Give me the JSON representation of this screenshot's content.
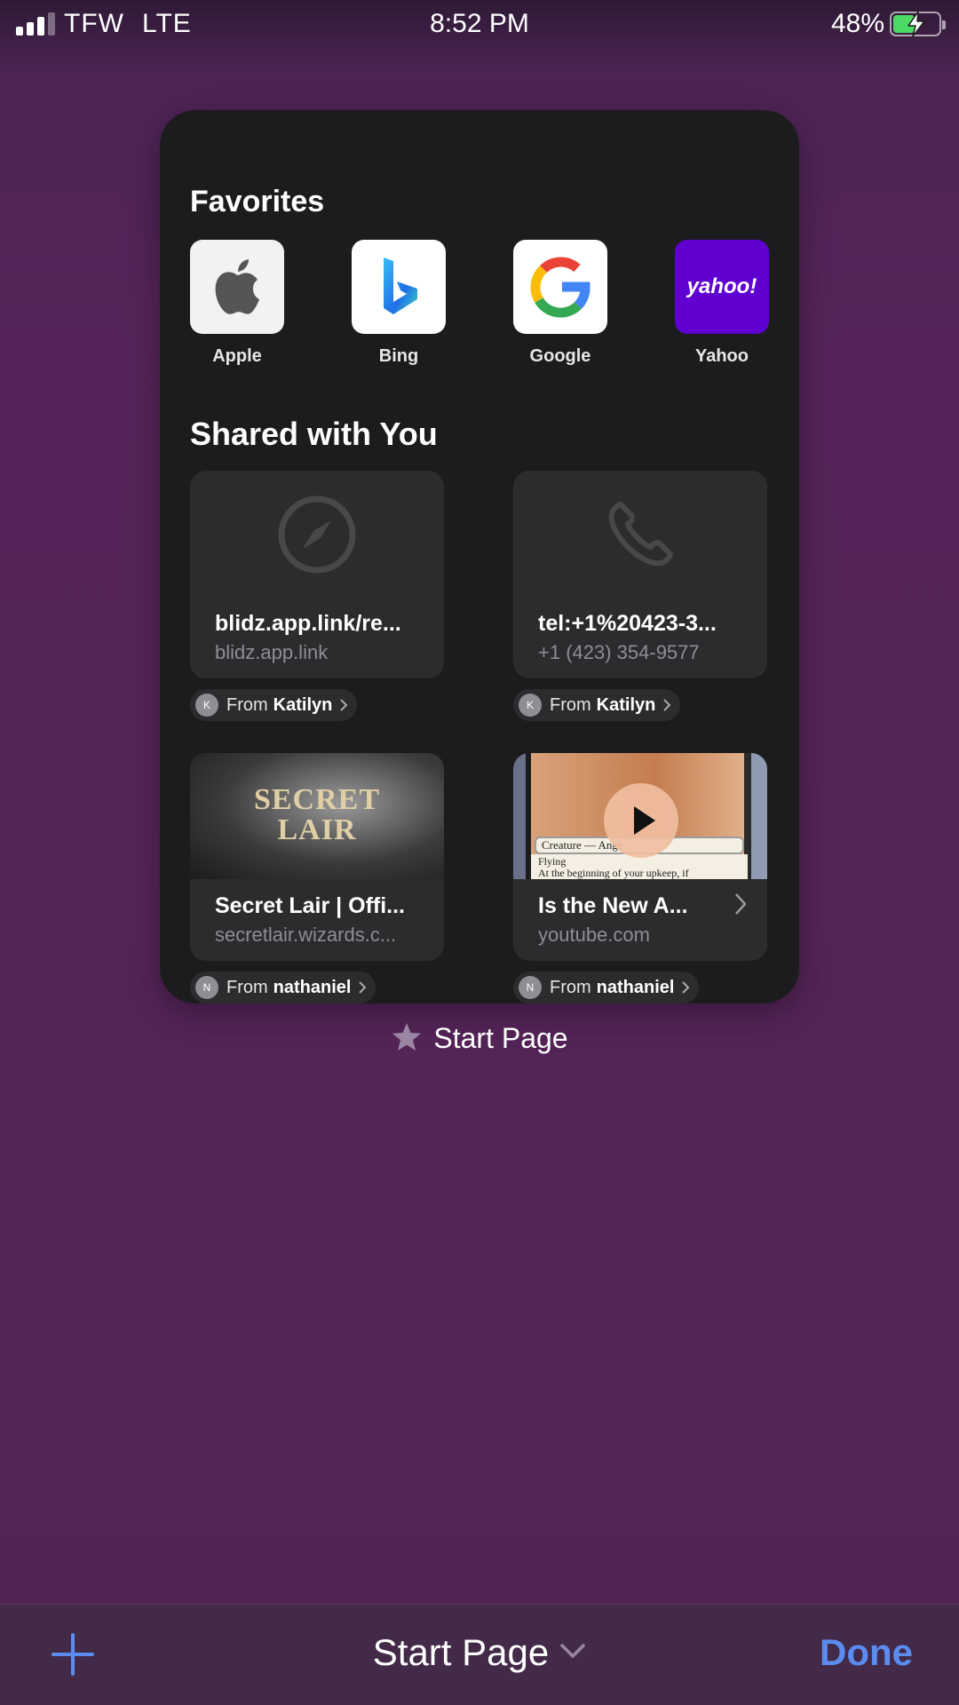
{
  "status_bar": {
    "carrier": "TFW",
    "network": "LTE",
    "time": "8:52 PM",
    "battery_percent": "48%",
    "battery_level": 0.48,
    "battery_charging": true
  },
  "start_page": {
    "favorites_title": "Favorites",
    "favorites": [
      {
        "label": "Apple",
        "icon": "apple-logo-icon"
      },
      {
        "label": "Bing",
        "icon": "bing-logo-icon"
      },
      {
        "label": "Google",
        "icon": "google-logo-icon"
      },
      {
        "label": "Yahoo",
        "icon": "yahoo-logo-icon",
        "logo_text": "yahoo!"
      }
    ],
    "shared_title": "Shared with You",
    "shared": [
      {
        "title": "blidz.app.link/re...",
        "subtitle": "blidz.app.link",
        "icon": "compass-icon",
        "from_prefix": "From",
        "from_name": "Katilyn",
        "avatar": "K"
      },
      {
        "title": "tel:+1%20423-3...",
        "subtitle": "+1 (423) 354-9577",
        "icon": "phone-icon",
        "from_prefix": "From",
        "from_name": "Katilyn",
        "avatar": "K"
      },
      {
        "title": "Secret Lair | Offi...",
        "subtitle": "secretlair.wizards.c...",
        "thumb_text_1": "SECRET",
        "thumb_text_2": "LAIR",
        "from_prefix": "From",
        "from_name": "nathaniel",
        "avatar": "N"
      },
      {
        "title": "Is the New A...",
        "subtitle": "youtube.com",
        "thumb_type_line": "Creature — Ange",
        "thumb_flying": "Flying",
        "thumb_rules": "At the beginning of your upkeep, if",
        "from_prefix": "From",
        "from_name": "nathaniel",
        "avatar": "N"
      }
    ]
  },
  "tab_caption": "Start Page",
  "toolbar": {
    "title": "Start Page",
    "done_label": "Done"
  },
  "colors": {
    "accent": "#5b8cf0",
    "background": "#522455",
    "card": "#1c1c1e",
    "yahoo": "#6001d2"
  }
}
